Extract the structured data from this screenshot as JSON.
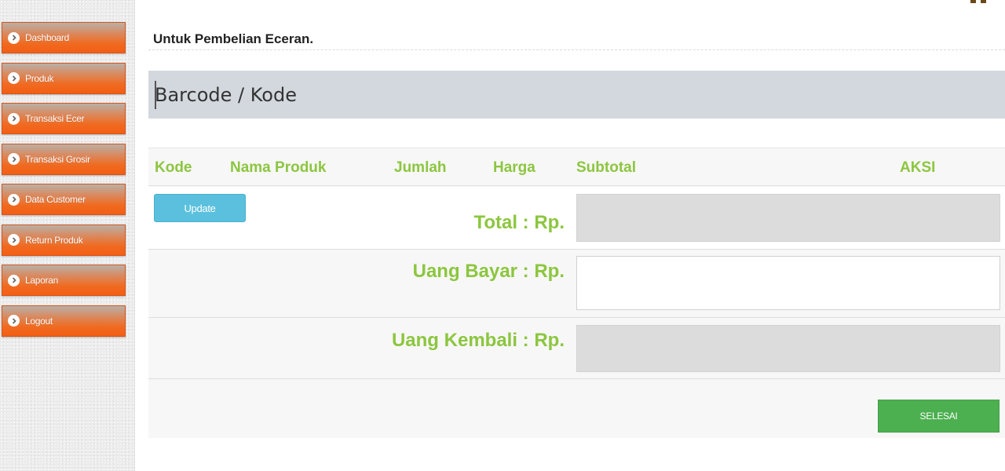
{
  "sidebar": {
    "items": [
      {
        "label": "Dashboard",
        "icon": "chevron-right-icon"
      },
      {
        "label": "Produk",
        "icon": "chevron-right-icon"
      },
      {
        "label": "Transaksi Ecer",
        "icon": "chevron-right-icon"
      },
      {
        "label": "Transaksi Grosir",
        "icon": "chevron-right-icon"
      },
      {
        "label": "Data Customer",
        "icon": "chevron-right-icon"
      },
      {
        "label": "Return Produk",
        "icon": "chevron-right-icon"
      },
      {
        "label": "Laporan",
        "icon": "chevron-right-icon"
      },
      {
        "label": "Logout",
        "icon": "chevron-right-icon"
      }
    ]
  },
  "main": {
    "title": "Untuk Pembelian Eceran.",
    "barcode": {
      "placeholder": "Barcode / Kode",
      "value": ""
    },
    "table": {
      "headers": {
        "kode": "Kode",
        "nama_produk": "Nama Produk",
        "jumlah": "Jumlah",
        "harga": "Harga",
        "subtotal": "Subtotal",
        "aksi": "AKSI"
      }
    },
    "update_label": "Update",
    "total": {
      "label": "Total : Rp.",
      "value": ""
    },
    "uang_bayar": {
      "label": "Uang Bayar : Rp.",
      "value": ""
    },
    "uang_kembali": {
      "label": "Uang Kembali : Rp.",
      "value": ""
    },
    "selesai_label": "SELESAI"
  },
  "colors": {
    "menu_orange": "#f25f14",
    "header_green": "#8cc63f",
    "update_blue": "#5bc0de",
    "selesai_green": "#4caf50",
    "barcode_bg": "#d3d8df"
  }
}
